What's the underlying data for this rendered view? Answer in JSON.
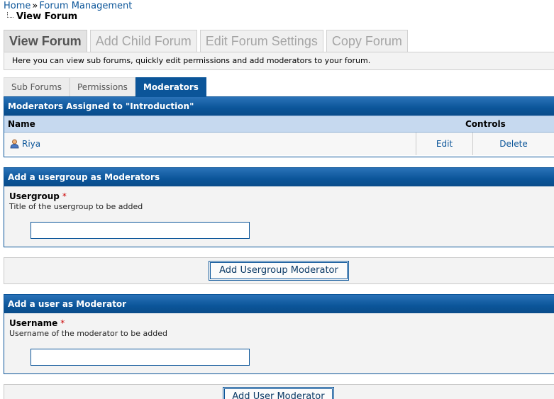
{
  "breadcrumb": {
    "home": "Home",
    "separator": "»",
    "section": "Forum Management",
    "current": "View Forum"
  },
  "tabs": [
    {
      "label": "View Forum",
      "active": true
    },
    {
      "label": "Add Child Forum",
      "active": false
    },
    {
      "label": "Edit Forum Settings",
      "active": false
    },
    {
      "label": "Copy Forum",
      "active": false
    }
  ],
  "tabs_description": "Here you can view sub forums, quickly edit permissions and add moderators to your forum.",
  "subtabs": [
    {
      "label": "Sub Forums",
      "active": false
    },
    {
      "label": "Permissions",
      "active": false
    },
    {
      "label": "Moderators",
      "active": true
    }
  ],
  "moderators": {
    "title": "Moderators Assigned to \"Introduction\"",
    "col_name": "Name",
    "col_controls": "Controls",
    "rows": [
      {
        "name": "Riya",
        "edit": "Edit",
        "delete": "Delete"
      }
    ]
  },
  "usergroup_form": {
    "title": "Add a usergroup as Moderators",
    "label": "Usergroup",
    "required_mark": "*",
    "description": "Title of the usergroup to be added",
    "value": "",
    "button": "Add Usergroup Moderator"
  },
  "user_form": {
    "title": "Add a user as Moderator",
    "label": "Username",
    "required_mark": "*",
    "description": "Username of the moderator to be added",
    "value": "",
    "button": "Add User Moderator"
  },
  "colors": {
    "accent": "#0b5599",
    "header_light": "#c6d9ef",
    "panel_bg": "#f3f3f3",
    "required": "#cc0000"
  }
}
